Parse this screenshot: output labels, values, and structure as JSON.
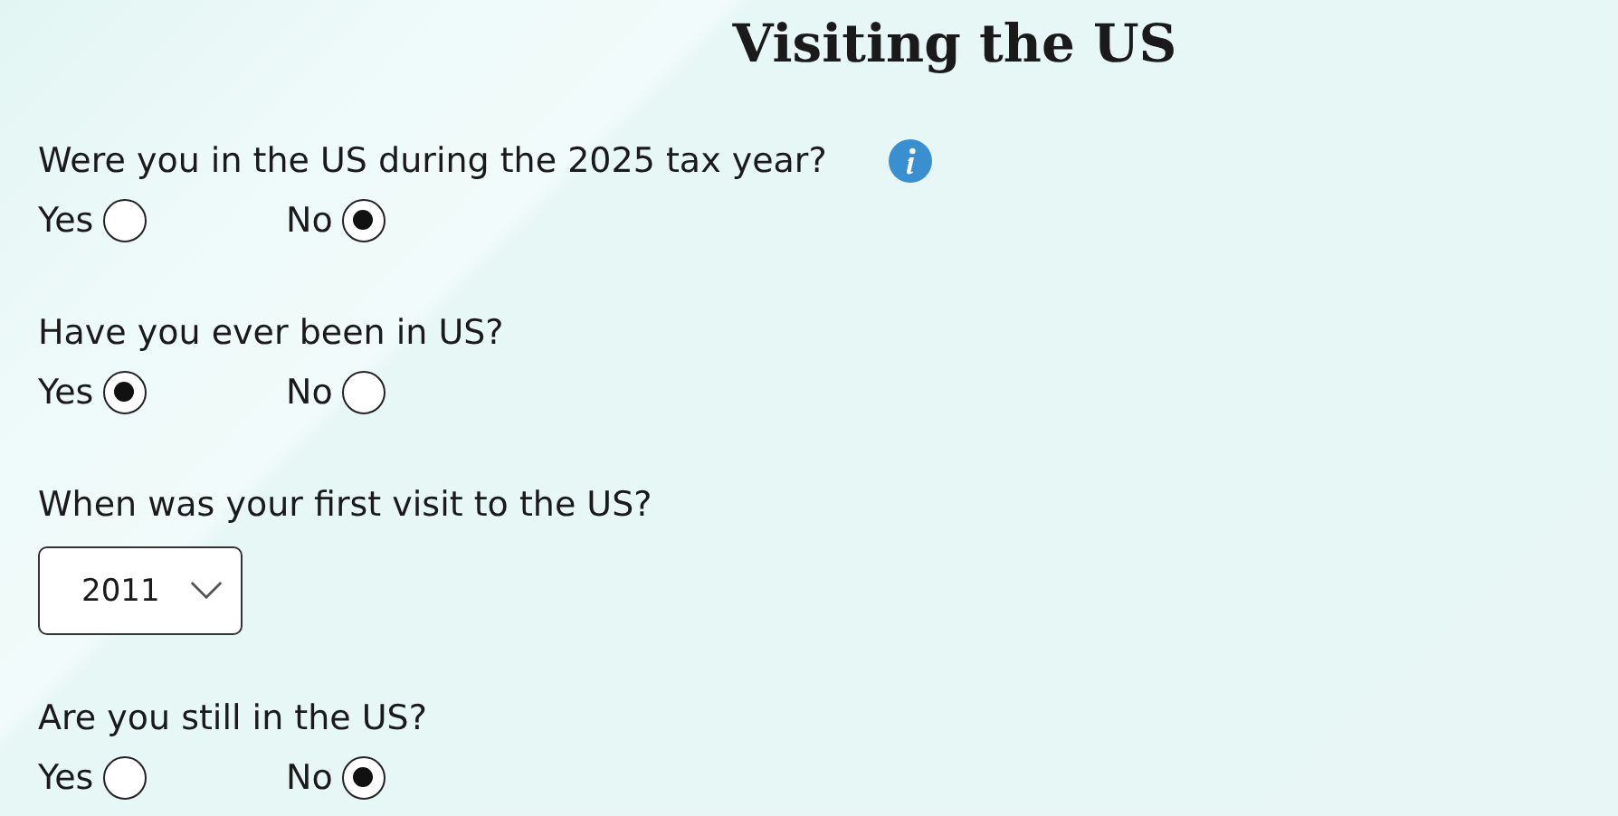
{
  "title": "Visiting the US",
  "questions": [
    {
      "kind": "radio",
      "label": "Were you in the US during the 2025 tax year?",
      "info": true,
      "options": [
        {
          "label": "Yes",
          "selected": false
        },
        {
          "label": "No",
          "selected": true
        }
      ]
    },
    {
      "kind": "radio",
      "label": "Have you ever been in US?",
      "info": false,
      "options": [
        {
          "label": "Yes",
          "selected": true
        },
        {
          "label": "No",
          "selected": false
        }
      ]
    },
    {
      "kind": "select",
      "label": "When was your first visit to the US?",
      "info": false,
      "value": "2011"
    },
    {
      "kind": "radio",
      "label": "Are you still in the US?",
      "info": false,
      "options": [
        {
          "label": "Yes",
          "selected": false
        },
        {
          "label": "No",
          "selected": true
        }
      ]
    }
  ]
}
